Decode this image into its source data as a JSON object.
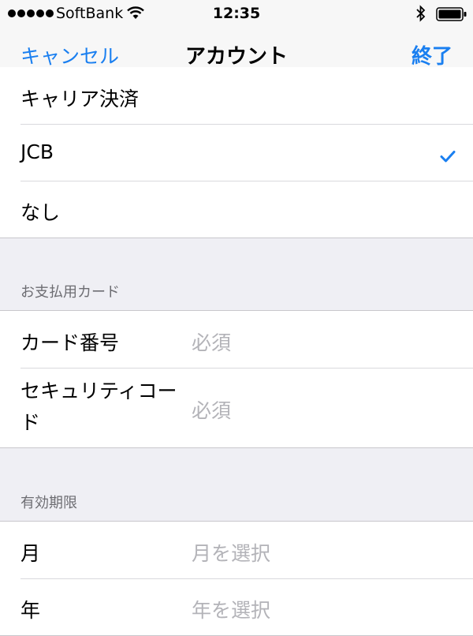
{
  "status_bar": {
    "carrier": "SoftBank",
    "time": "12:35",
    "icons": [
      "signal-dots-icon",
      "wifi-icon",
      "bluetooth-icon",
      "battery-icon"
    ]
  },
  "nav": {
    "cancel_label": "キャンセル",
    "title": "アカウント",
    "done_label": "終了"
  },
  "payment_methods": {
    "items": [
      {
        "label": "キャリア決済",
        "selected": false
      },
      {
        "label": "JCB",
        "selected": true
      },
      {
        "label": "なし",
        "selected": false
      }
    ]
  },
  "card_section": {
    "header": "お支払用カード",
    "card_number": {
      "label": "カード番号",
      "placeholder": "必須"
    },
    "security_code": {
      "label": "セキュリティコード",
      "placeholder": "必須"
    }
  },
  "expiry_section": {
    "header": "有効期限",
    "month": {
      "label": "月",
      "placeholder": "月を選択"
    },
    "year": {
      "label": "年",
      "placeholder": "年を選択"
    }
  },
  "colors": {
    "accent": "#1a7ff0",
    "background": "#efeff4",
    "placeholder": "#b3b3b8"
  }
}
